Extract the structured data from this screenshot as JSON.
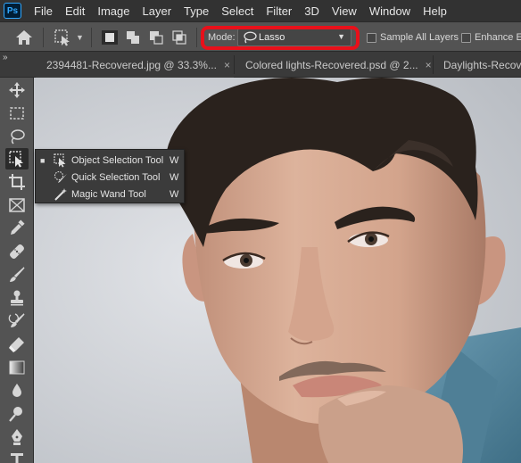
{
  "app": {
    "logo_text": "Ps"
  },
  "menu": [
    "File",
    "Edit",
    "Image",
    "Layer",
    "Type",
    "Select",
    "Filter",
    "3D",
    "View",
    "Window",
    "Help"
  ],
  "options": {
    "mode_label": "Mode:",
    "mode_value": "Lasso",
    "sample_all_layers": {
      "label": "Sample All Layers",
      "checked": false
    },
    "enhance_edge": {
      "label": "Enhance Ec",
      "checked": false
    }
  },
  "tabs": [
    {
      "label": "2394481-Recovered.jpg @ 33.3%...",
      "close": "×"
    },
    {
      "label": "Colored lights-Recovered.psd @ 2...",
      "close": "×"
    },
    {
      "label": "Daylights-Recovered",
      "close": ""
    }
  ],
  "flyout": {
    "items": [
      {
        "label": "Object Selection Tool",
        "shortcut": "W",
        "selected": true,
        "bullet": "■"
      },
      {
        "label": "Quick Selection Tool",
        "shortcut": "W",
        "selected": false,
        "bullet": ""
      },
      {
        "label": "Magic Wand Tool",
        "shortcut": "W",
        "selected": false,
        "bullet": ""
      }
    ]
  },
  "colors": {
    "highlight": "#e8101a",
    "shirt": "#5f8fa6",
    "hair": "#2a221d",
    "skin": "#d9a990"
  }
}
